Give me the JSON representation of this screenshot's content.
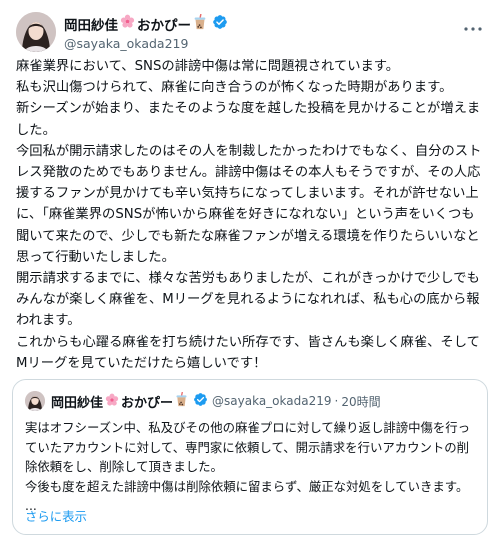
{
  "post": {
    "author_name": "岡田紗佳",
    "author_suffix": "おかぴー",
    "handle": "@sayaka_okada219",
    "paragraphs": [
      "麻雀業界において、SNSの誹謗中傷は常に問題視されています。",
      "私も沢山傷つけられて、麻雀に向き合うのが怖くなった時期があります。",
      "新シーズンが始まり、またそのような度を越した投稿を見かけることが増えました。",
      "今回私が開示請求したのはその人を制裁したかったわけでもなく、自分のストレス発散のためでもありません。誹謗中傷はその本人もそうですが、その人応援するファンが見かけても辛い気持ちになってしまいます。それが許せない上に、「麻雀業界のSNSが怖いから麻雀を好きになれない」という声をいくつも聞いて来たので、少しでも新たな麻雀ファンが増える環境を作りたらいいなと思って行動いたしました。",
      "開示請求するまでに、様々な苦労もありましたが、これがきっかけで少しでもみんなが楽しく麻雀を、Mリーグを見れるようになれれば、私も心の底から報われます。",
      "これからも心躍る麻雀を打ち続けたい所存です、皆さんも楽しく麻雀、そしてMリーグを見ていただけたら嬉しいです！"
    ]
  },
  "quote": {
    "author_name": "岡田紗佳",
    "author_suffix": "おかぴー",
    "handle": "@sayaka_okada219",
    "dot": "·",
    "time": "20時間",
    "paragraphs": [
      "実はオフシーズン中、私及びその他の麻雀プロに対して繰り返し誹謗中傷を行っていたアカウントに対して、専門家に依頼して、開示請求を行いアカウントの削除依頼をし、削除して頂きました。",
      "今後も度を超えた誹謗中傷は削除依頼に留まらず、厳正な対処をしていきます。",
      "..."
    ],
    "show_more": "さらに表示"
  },
  "icons": {
    "flower": "cherry-blossom-icon",
    "drink": "bubble-tea-icon",
    "verified": "verified-badge-icon",
    "more": "more-icon"
  },
  "colors": {
    "verified": "#1d9bf0",
    "link": "#1d9bf0",
    "secondary_text": "#536471",
    "border": "#cfd9de"
  }
}
